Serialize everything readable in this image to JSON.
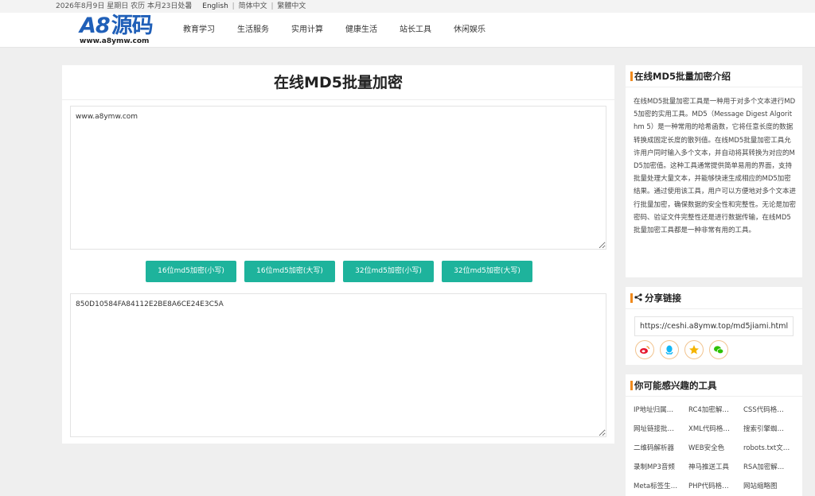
{
  "topbar": {
    "date": "2026年8月9日 星期日 农历 本月23日处暑",
    "lang_en": "English",
    "lang_sep": "|",
    "lang_cn": "简体中文",
    "lang_tw": "繁體中文"
  },
  "header": {
    "logo_text": "A8",
    "logo_cn": "源码",
    "logo_url": "www.a8ymw.com",
    "nav": [
      "教育学习",
      "生活服务",
      "实用计算",
      "健康生活",
      "站长工具",
      "休闲娱乐"
    ]
  },
  "main": {
    "title": "在线MD5批量加密",
    "input_value": "www.a8ymw.com",
    "output_value": "850D10584FA84112E2BE8A6CE24E3C5A",
    "buttons": [
      "16位md5加密(小写)",
      "16位md5加密(大写)",
      "32位md5加密(小写)",
      "32位md5加密(大写)"
    ]
  },
  "sidebar": {
    "intro": {
      "title": "在线MD5批量加密介绍",
      "text": "在线MD5批量加密工具是一种用于对多个文本进行MD5加密的实用工具。MD5（Message Digest Algorithm 5）是一种常用的哈希函数，它将任意长度的数据转换成固定长度的散列值。在线MD5批量加密工具允许用户同时输入多个文本，并自动将其转换为对应的MD5加密值。这种工具通常提供简单易用的界面，支持批量处理大量文本，并能够快速生成相应的MD5加密结果。通过使用该工具，用户可以方便地对多个文本进行批量加密，确保数据的安全性和完整性。无论是加密密码、验证文件完整性还是进行数据传输，在线MD5批量加密工具都是一种非常有用的工具。"
    },
    "share": {
      "title": "分享链接",
      "url": "https://ceshi.a8ymw.top/md5jiami.html"
    },
    "tools": {
      "title": "你可能感兴趣的工具",
      "items": [
        "IP地址归属…",
        "RC4加密解…",
        "CSS代码格…",
        "网址链接批…",
        "XML代码格…",
        "搜索引擎蜘…",
        "二维码解析器",
        "WEB安全色",
        "robots.txt文…",
        "录制MP3音频",
        "神马推送工具",
        "RSA加密解…",
        "Meta标签生…",
        "PHP代码格…",
        "网站缩略图"
      ]
    }
  },
  "colors": {
    "accent": "#1eb39c",
    "orange_bar": "#f08a1d",
    "logo_blue": "#1f5fb8"
  }
}
